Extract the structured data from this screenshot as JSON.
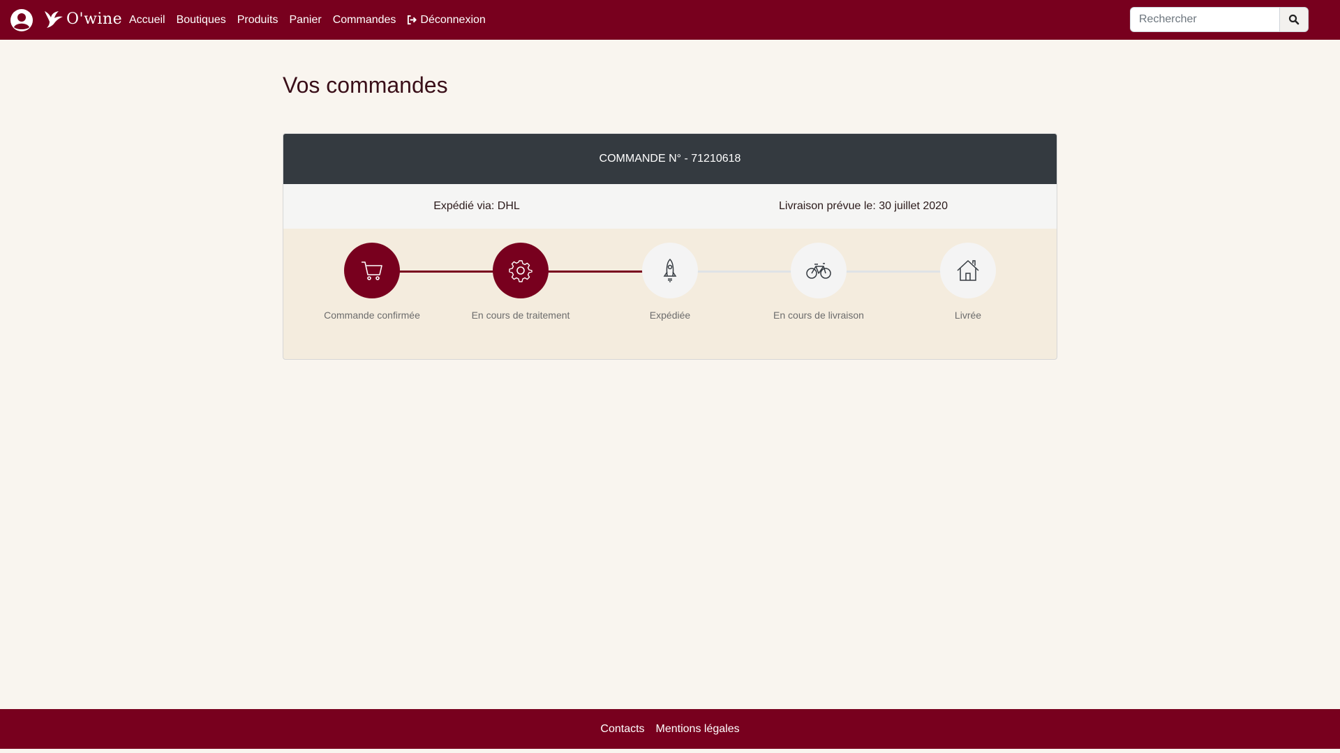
{
  "navbar": {
    "brand": "O'wine",
    "links": [
      "Accueil",
      "Boutiques",
      "Produits",
      "Panier",
      "Commandes"
    ],
    "logout_label": "Déconnexion",
    "search_placeholder": "Rechercher",
    "icons": {
      "user": "user-circle-icon",
      "brand": "bird-logo-icon",
      "logout": "sign-out-icon",
      "search": "search-icon"
    }
  },
  "page": {
    "title": "Vos commandes"
  },
  "order": {
    "header": "COMMANDE N° - 71210618",
    "shipped_via": "Expédié via: DHL",
    "delivery_date": "Livraison prévue le: 30 juillet 2020",
    "steps": [
      {
        "label": "Commande confirmée",
        "icon": "cart-icon",
        "done": true
      },
      {
        "label": "En cours de traitement",
        "icon": "gear-icon",
        "done": true
      },
      {
        "label": "Expédiée",
        "icon": "rocket-icon",
        "done": false
      },
      {
        "label": "En cours de livraison",
        "icon": "bicycle-icon",
        "done": false
      },
      {
        "label": "Livrée",
        "icon": "home-icon",
        "done": false
      }
    ]
  },
  "footer": {
    "links": [
      "Contacts",
      "Mentions légales"
    ]
  },
  "colors": {
    "brand": "#78001e",
    "header_dark": "#343a40",
    "background": "#f9f5ef",
    "tracker_bg": "#f4ecde"
  }
}
